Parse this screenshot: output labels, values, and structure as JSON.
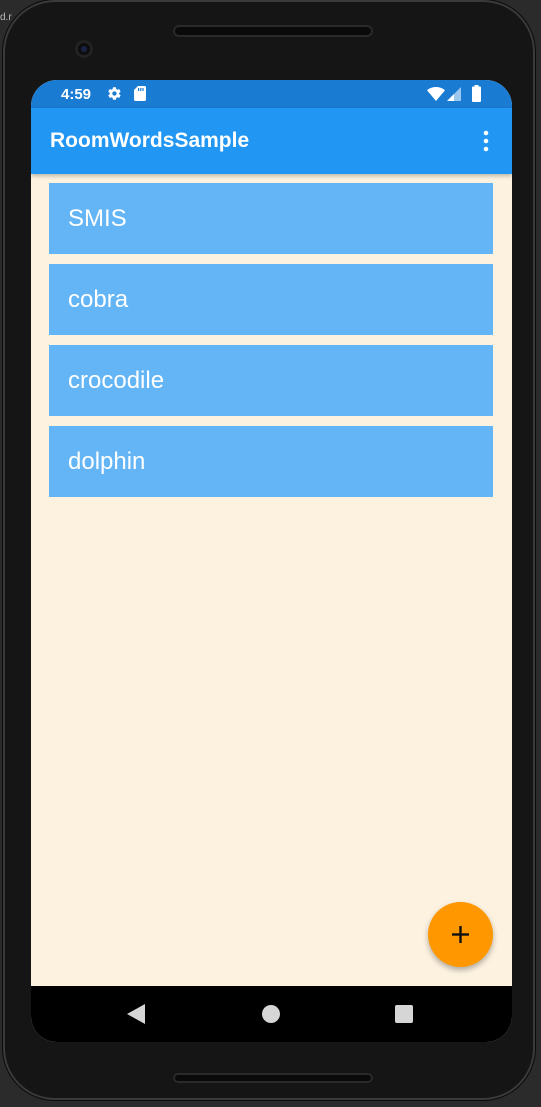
{
  "status_bar": {
    "time": "4:59",
    "icons": [
      "gear-icon",
      "sd-card-icon",
      "wifi-icon",
      "signal-icon",
      "battery-icon"
    ]
  },
  "app_bar": {
    "title": "RoomWordsSample",
    "menu_icon": "overflow-menu-icon"
  },
  "words": [
    "SMIS",
    "cobra",
    "crocodile",
    "dolphin"
  ],
  "fab": {
    "icon": "plus-icon"
  },
  "nav_bar": {
    "icons": [
      "back-icon",
      "home-icon",
      "recents-icon"
    ]
  },
  "colors": {
    "status_bar": "#1a7bd3",
    "app_bar": "#2196f3",
    "list_item": "#64b5f6",
    "background": "#fdf2e0",
    "fab": "#ff9800"
  }
}
